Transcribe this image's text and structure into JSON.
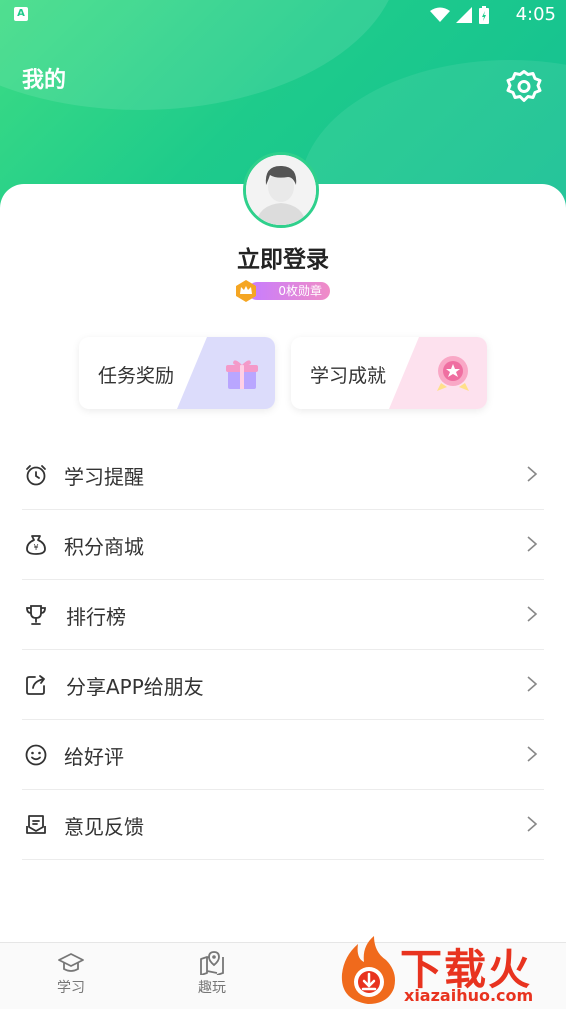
{
  "status_bar": {
    "time": "4:05",
    "sim_label": "A"
  },
  "header": {
    "title": "我的"
  },
  "profile": {
    "login_label": "立即登录",
    "medal_label": "0枚勋章"
  },
  "quick_tiles": [
    {
      "label": "任务奖励"
    },
    {
      "label": "学习成就"
    }
  ],
  "menu": [
    {
      "label": "学习提醒"
    },
    {
      "label": "积分商城"
    },
    {
      "label": "排行榜"
    },
    {
      "label": "分享APP给朋友"
    },
    {
      "label": "给好评"
    },
    {
      "label": "意见反馈"
    }
  ],
  "tabs": [
    {
      "label": "学习"
    },
    {
      "label": "趣玩"
    }
  ],
  "watermark": {
    "text": "下载火",
    "url": "xiazaihuo.com"
  },
  "colors": {
    "brand_green": "#1ecb8b",
    "accent_red": "#e8331f",
    "medal_pink": "#f08cc6"
  }
}
